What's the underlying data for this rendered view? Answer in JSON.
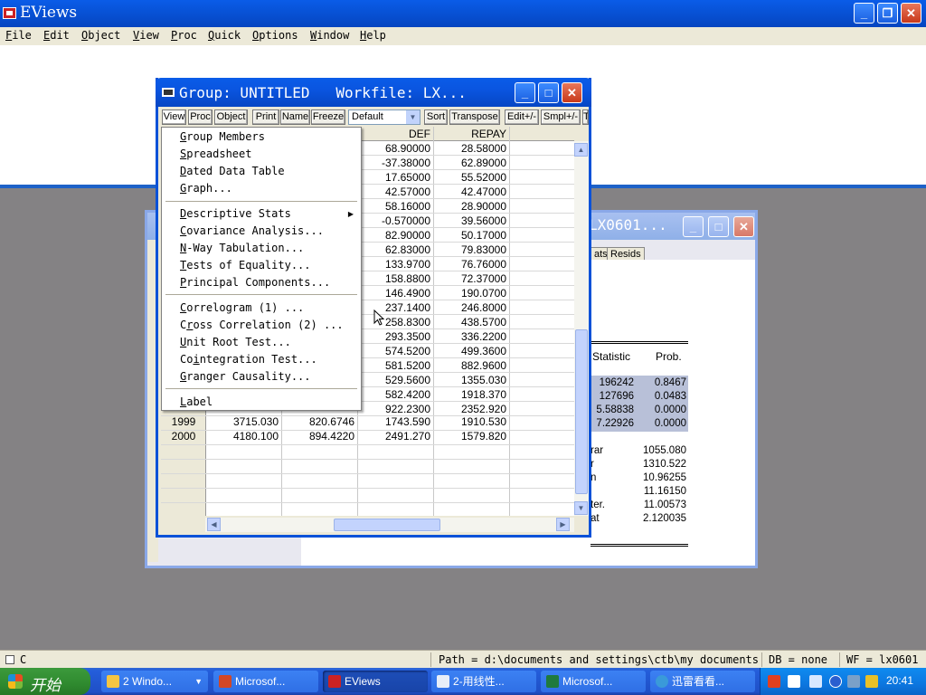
{
  "app": {
    "title": "EViews",
    "menu": [
      "File",
      "Edit",
      "Object",
      "View",
      "Proc",
      "Quick",
      "Options",
      "Window",
      "Help"
    ]
  },
  "equation_window": {
    "title": "LX0601...",
    "toolbar": [
      "ats",
      "Resids"
    ],
    "headers": [
      "Statistic",
      "Prob."
    ],
    "stats": [
      {
        "stat": "196242",
        "prob": "0.8467"
      },
      {
        "stat": "127696",
        "prob": "0.0483"
      },
      {
        "stat": "5.58838",
        "prob": "0.0000"
      },
      {
        "stat": "7.22926",
        "prob": "0.0000"
      }
    ],
    "summary": [
      {
        "label": "rar",
        "value": "1055.080"
      },
      {
        "label": "r",
        "value": "1310.522"
      },
      {
        "label": "n",
        "value": "10.96255"
      },
      {
        "label": "",
        "value": "11.16150"
      },
      {
        "label": "ter.",
        "value": "11.00573"
      },
      {
        "label": "at",
        "value": "2.120035"
      }
    ]
  },
  "group_window": {
    "title": "Group: UNTITLED   Workfile: LX...",
    "toolbar": {
      "view": "View",
      "proc": "Proc",
      "object": "Object",
      "print": "Print",
      "name": "Name",
      "freeze": "Freeze",
      "default_select": "Default",
      "sort": "Sort",
      "transpose": "Transpose",
      "edit": "Edit+/-",
      "smpl": "Smpl+/-",
      "more": "T"
    },
    "columns": [
      "DEF",
      "REPAY"
    ],
    "rows": [
      {
        "def": "68.90000",
        "repay": "28.58000"
      },
      {
        "def": "-37.38000",
        "repay": "62.89000"
      },
      {
        "def": "17.65000",
        "repay": "55.52000"
      },
      {
        "def": "42.57000",
        "repay": "42.47000"
      },
      {
        "def": "58.16000",
        "repay": "28.90000"
      },
      {
        "def": "-0.570000",
        "repay": "39.56000"
      },
      {
        "def": "82.90000",
        "repay": "50.17000"
      },
      {
        "def": "62.83000",
        "repay": "79.83000"
      },
      {
        "def": "133.9700",
        "repay": "76.76000"
      },
      {
        "def": "158.8800",
        "repay": "72.37000"
      },
      {
        "def": "146.4900",
        "repay": "190.0700"
      },
      {
        "def": "237.1400",
        "repay": "246.8000"
      },
      {
        "def": "258.8300",
        "repay": "438.5700"
      },
      {
        "def": "293.3500",
        "repay": "336.2200"
      },
      {
        "def": "574.5200",
        "repay": "499.3600"
      },
      {
        "def": "581.5200",
        "repay": "882.9600"
      },
      {
        "def": "529.5600",
        "repay": "1355.030"
      },
      {
        "def": "582.4200",
        "repay": "1918.370"
      },
      {
        "def": "922.2300",
        "repay": "2352.920"
      }
    ],
    "full_rows": [
      {
        "obs": "1999",
        "c1": "3715.030",
        "c2": "820.6746",
        "def": "1743.590",
        "repay": "1910.530"
      },
      {
        "obs": "2000",
        "c1": "4180.100",
        "c2": "894.4220",
        "def": "2491.270",
        "repay": "1579.820"
      }
    ]
  },
  "view_menu": {
    "items": [
      {
        "pre": "",
        "ul": "G",
        "post": "roup Members"
      },
      {
        "pre": "",
        "ul": "S",
        "post": "preadsheet"
      },
      {
        "pre": "",
        "ul": "D",
        "post": "ated Data Table"
      },
      {
        "pre": "",
        "ul": "G",
        "post": "raph..."
      },
      {
        "pre": "",
        "ul": "D",
        "post": "escriptive Stats"
      },
      {
        "pre": "",
        "ul": "C",
        "post": "ovariance Analysis..."
      },
      {
        "pre": "",
        "ul": "N",
        "post": "-Way Tabulation..."
      },
      {
        "pre": "",
        "ul": "T",
        "post": "ests of Equality..."
      },
      {
        "pre": "",
        "ul": "P",
        "post": "rincipal Components..."
      },
      {
        "pre": "",
        "ul": "C",
        "post": "orrelogram (1) ..."
      },
      {
        "pre": "C",
        "ul": "r",
        "post": "oss Correlation (2) ..."
      },
      {
        "pre": "",
        "ul": "U",
        "post": "nit Root Test..."
      },
      {
        "pre": "Co",
        "ul": "i",
        "post": "ntegration Test..."
      },
      {
        "pre": "",
        "ul": "G",
        "post": "ranger Causality..."
      },
      {
        "pre": "",
        "ul": "L",
        "post": "abel"
      }
    ]
  },
  "status_bar": {
    "command": "C",
    "path": "Path = d:\\documents and settings\\ctb\\my documents",
    "db": "DB = none",
    "wf": "WF = lx0601"
  },
  "taskbar": {
    "start": "开始",
    "tasks": [
      "2 Windo...",
      "Microsof...",
      "EViews",
      "2-用线性...",
      "Microsof...",
      "迅雷看看..."
    ],
    "clock": "20:41"
  },
  "colors": {
    "title_blue": "#0a5ce8",
    "taskbar_blue": "#245edb",
    "start_green": "#2f8a2f"
  }
}
